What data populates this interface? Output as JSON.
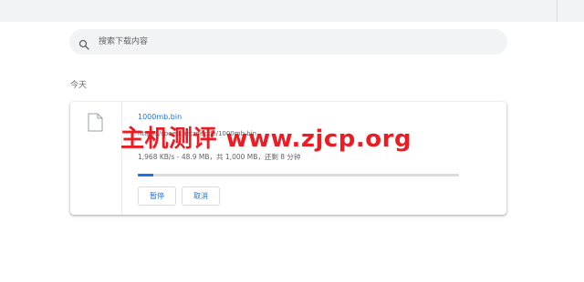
{
  "search": {
    "placeholder": "搜索下载内容"
  },
  "section": {
    "title": "今天"
  },
  "download": {
    "filename": "1000mb.bin",
    "url": "https://speed.hetzner.de/1000mb.bin",
    "status": "1,968 KB/s - 48.9 MB，共 1,000 MB，还剩 8 分钟",
    "progress_fraction": 0.049,
    "pause_label": "暂停",
    "cancel_label": "取消"
  },
  "watermark": {
    "text": "主机测评 www.zjcp.org"
  },
  "colors": {
    "accent": "#1a73e8",
    "watermark": "#ec1c24"
  },
  "icons": {
    "search": "search-icon",
    "file": "file-icon"
  }
}
